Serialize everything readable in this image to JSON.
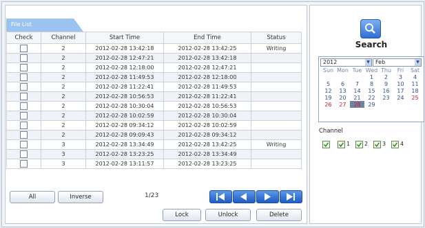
{
  "file_list": {
    "tab_label": "File List",
    "columns": [
      "Check",
      "Channel",
      "Start Time",
      "End Time",
      "Status"
    ],
    "rows": [
      {
        "channel": "2",
        "start": "2012-02-28 13:42:18",
        "end": "2012-02-28 13:42:25",
        "status": "Writing"
      },
      {
        "channel": "2",
        "start": "2012-02-28 12:47:21",
        "end": "2012-02-28 13:42:18",
        "status": ""
      },
      {
        "channel": "2",
        "start": "2012-02-28 12:18:00",
        "end": "2012-02-28 12:47:21",
        "status": ""
      },
      {
        "channel": "2",
        "start": "2012-02-28 11:49:53",
        "end": "2012-02-28 12:18:00",
        "status": ""
      },
      {
        "channel": "2",
        "start": "2012-02-28 11:22:41",
        "end": "2012-02-28 11:49:53",
        "status": ""
      },
      {
        "channel": "2",
        "start": "2012-02-28 10:56:53",
        "end": "2012-02-28 11:22:41",
        "status": ""
      },
      {
        "channel": "2",
        "start": "2012-02-28 10:30:04",
        "end": "2012-02-28 10:56:53",
        "status": ""
      },
      {
        "channel": "2",
        "start": "2012-02-28 10:02:59",
        "end": "2012-02-28 10:30:04",
        "status": ""
      },
      {
        "channel": "2",
        "start": "2012-02-28 09:34:12",
        "end": "2012-02-28 10:02:59",
        "status": ""
      },
      {
        "channel": "2",
        "start": "2012-02-28 09:09:43",
        "end": "2012-02-28 09:34:12",
        "status": ""
      },
      {
        "channel": "3",
        "start": "2012-02-28 13:34:49",
        "end": "2012-02-28 13:42:25",
        "status": "Writing"
      },
      {
        "channel": "3",
        "start": "2012-02-28 13:23:25",
        "end": "2012-02-28 13:34:49",
        "status": ""
      },
      {
        "channel": "3",
        "start": "2012-02-28 13:11:57",
        "end": "2012-02-28 13:23:25",
        "status": ""
      }
    ]
  },
  "controls": {
    "all_label": "All",
    "inverse_label": "Inverse",
    "page_indicator": "1/23",
    "lock_label": "Lock",
    "unlock_label": "Unlock",
    "delete_label": "Delete",
    "nav_icons": [
      "first-page-icon",
      "prev-page-icon",
      "next-page-icon",
      "last-page-icon"
    ]
  },
  "search": {
    "label": "Search",
    "icon": "search-icon"
  },
  "calendar": {
    "year": "2012",
    "month": "Feb",
    "weekdays": [
      "Sun",
      "Mon",
      "Tue",
      "Wed",
      "Thu",
      "Fri",
      "Sat"
    ],
    "weeks": [
      [
        "",
        "",
        "",
        "1",
        "2",
        "3",
        "4"
      ],
      [
        "5",
        "6",
        "7",
        "8",
        "9",
        "10",
        "11"
      ],
      [
        "12",
        "13",
        "14",
        "15",
        "16",
        "17",
        "18"
      ],
      [
        "19",
        "20",
        "21",
        "22",
        "23",
        "24",
        "25"
      ],
      [
        "26",
        "27",
        "28",
        "29",
        "",
        "",
        ""
      ]
    ],
    "recorded_days": [
      "25",
      "26",
      "27",
      "28"
    ],
    "selected_day": "28"
  },
  "channels": {
    "label": "Channel",
    "items": [
      {
        "label": "",
        "checked": true
      },
      {
        "label": "1",
        "checked": true
      },
      {
        "label": "2",
        "checked": true
      },
      {
        "label": "3",
        "checked": true
      },
      {
        "label": "4",
        "checked": true
      }
    ]
  },
  "colors": {
    "accent": "#2e6fd0",
    "recorded_day": "#d3182a",
    "tab": "#9cc3ef"
  }
}
